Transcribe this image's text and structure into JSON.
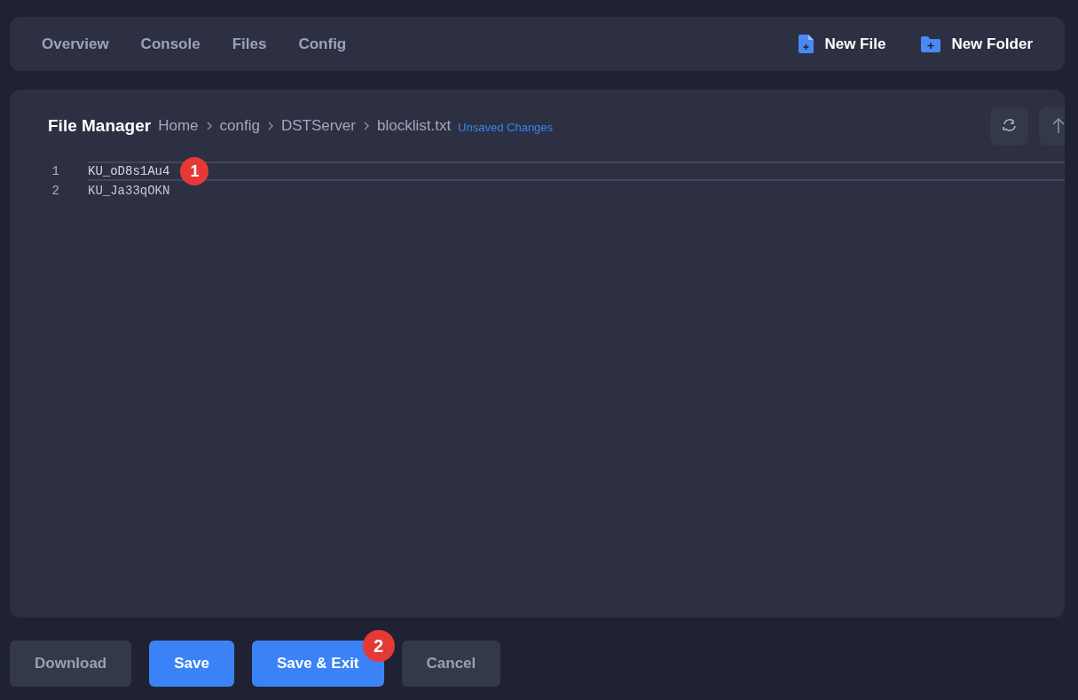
{
  "nav": {
    "tabs": [
      {
        "label": "Overview",
        "selected": false
      },
      {
        "label": "Console",
        "selected": false
      },
      {
        "label": "Files",
        "selected": false
      },
      {
        "label": "Config",
        "selected": false
      }
    ],
    "actions": [
      {
        "kind": "file",
        "label": "New File"
      },
      {
        "kind": "folder",
        "label": "New Folder"
      }
    ]
  },
  "file_manager": {
    "title": "File Manager",
    "breadcrumb": [
      "Home",
      "config",
      "DSTServer",
      "blocklist.txt"
    ],
    "status": "Unsaved Changes",
    "toolbar": [
      {
        "kind": "refresh"
      },
      {
        "kind": "up"
      }
    ],
    "editor": {
      "lines": [
        {
          "number": "1",
          "text": "KU_oD8s1Au4",
          "active": true,
          "marker": "1"
        },
        {
          "number": "2",
          "text": "KU_Ja33qOKN",
          "active": false
        }
      ]
    }
  },
  "buttons": [
    {
      "label": "Download",
      "kind": "secondary"
    },
    {
      "label": "Save",
      "kind": "primary"
    },
    {
      "label": "Save & Exit",
      "kind": "primary",
      "marker": "2"
    },
    {
      "label": "Cancel",
      "kind": "secondary"
    }
  ]
}
